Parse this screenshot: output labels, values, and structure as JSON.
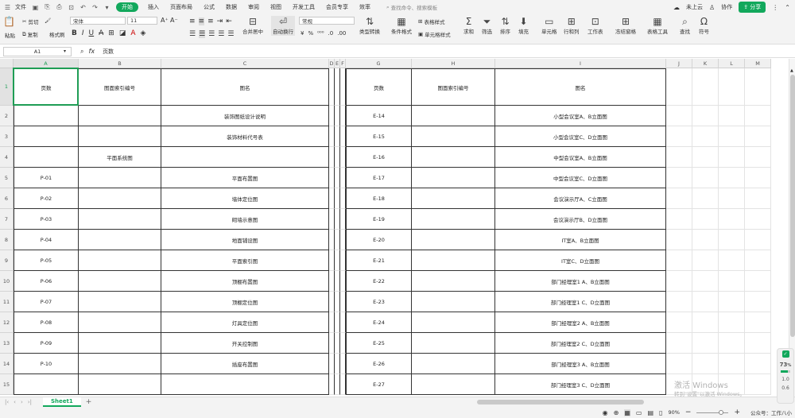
{
  "menu": {
    "file": "文件",
    "tabs": [
      "开始",
      "插入",
      "页面布局",
      "公式",
      "数据",
      "审阅",
      "视图",
      "开发工具",
      "会员专享",
      "效率"
    ],
    "search_placeholder": "查找命令、搜索模板",
    "cloud": "未上云",
    "collab": "协作",
    "share": "分享"
  },
  "ribbon": {
    "cut": "剪切",
    "paste": "粘贴",
    "copy": "复制",
    "format_painter": "格式刷",
    "font_name": "宋体",
    "font_size": "11",
    "merge": "合并居中",
    "wrap": "自动换行",
    "number_format": "常规",
    "type_convert": "类型转换",
    "cond_format": "条件格式",
    "table_style": "表格样式",
    "cell_style": "单元格样式",
    "sum": "求和",
    "filter": "筛选",
    "sort": "排序",
    "fill": "填充",
    "cell": "单元格",
    "rowcol": "行和列",
    "sheet": "工作表",
    "freeze": "冻结窗格",
    "table_tools": "表格工具",
    "find": "查找",
    "symbol": "符号"
  },
  "formula_bar": {
    "cell_ref": "A1",
    "fx": "fx",
    "content": "页数"
  },
  "columns": [
    "A",
    "B",
    "C",
    "D",
    "E",
    "F",
    "G",
    "H",
    "I",
    "J",
    "K",
    "L",
    "M"
  ],
  "rows": [
    "1",
    "2",
    "3",
    "4",
    "5",
    "6",
    "7",
    "8",
    "9",
    "10",
    "11",
    "12",
    "13",
    "14",
    "15"
  ],
  "left_table": {
    "headers": [
      "页数",
      "图面索引编号",
      "图名"
    ],
    "rows": [
      [
        "",
        "",
        "装饰图纸设计说明"
      ],
      [
        "",
        "",
        "装饰材料代号表"
      ],
      [
        "",
        "平面系统图",
        ""
      ],
      [
        "P-01",
        "",
        "平面布置图"
      ],
      [
        "P-02",
        "",
        "墙体定位图"
      ],
      [
        "P-03",
        "",
        "砌墙示意图"
      ],
      [
        "P-04",
        "",
        "地面铺设图"
      ],
      [
        "P-05",
        "",
        "平面索引图"
      ],
      [
        "P-06",
        "",
        "顶棚布置图"
      ],
      [
        "P-07",
        "",
        "顶棚定位图"
      ],
      [
        "P-08",
        "",
        "灯具定位图"
      ],
      [
        "P-09",
        "",
        "开关控制图"
      ],
      [
        "P-10",
        "",
        "插座布置图"
      ],
      [
        "",
        "",
        ""
      ]
    ]
  },
  "right_table": {
    "headers": [
      "页数",
      "图面索引编号",
      "图名"
    ],
    "rows": [
      [
        "E-14",
        "",
        "小型会议室A、B立面图"
      ],
      [
        "E-15",
        "",
        "小型会议室C、D立面图"
      ],
      [
        "E-16",
        "",
        "中型会议室A、B立面图"
      ],
      [
        "E-17",
        "",
        "中型会议室C、D立面图"
      ],
      [
        "E-18",
        "",
        "会议演示厅A、C立面图"
      ],
      [
        "E-19",
        "",
        "会议演示厅B、D立面图"
      ],
      [
        "E-20",
        "",
        "IT室A、B立面图"
      ],
      [
        "E-21",
        "",
        "IT室C、D立面图"
      ],
      [
        "E-22",
        "",
        "部门经理室1 A、B立面图"
      ],
      [
        "E-23",
        "",
        "部门经理室1 C、D立面图"
      ],
      [
        "E-24",
        "",
        "部门经理室2 A、B立面图"
      ],
      [
        "E-25",
        "",
        "部门经理室2 C、D立面图"
      ],
      [
        "E-26",
        "",
        "部门经理室3 A、B立面图"
      ],
      [
        "E-27",
        "",
        "部门经理室3 C、D立面图"
      ]
    ]
  },
  "sheet_tabs": [
    "Sheet1"
  ],
  "status": {
    "zoom": "90%",
    "notice": "公众号：工作八小"
  },
  "watermark": {
    "line1": "激活 Windows",
    "line2": "转到\"设置\"以激活 Windows。"
  },
  "perf": {
    "value": "73",
    "unit": "%",
    "stat1": "1.0",
    "stat2": "0.6"
  },
  "colors": {
    "accent": "#12a85c",
    "selection": "#1f9d55"
  }
}
